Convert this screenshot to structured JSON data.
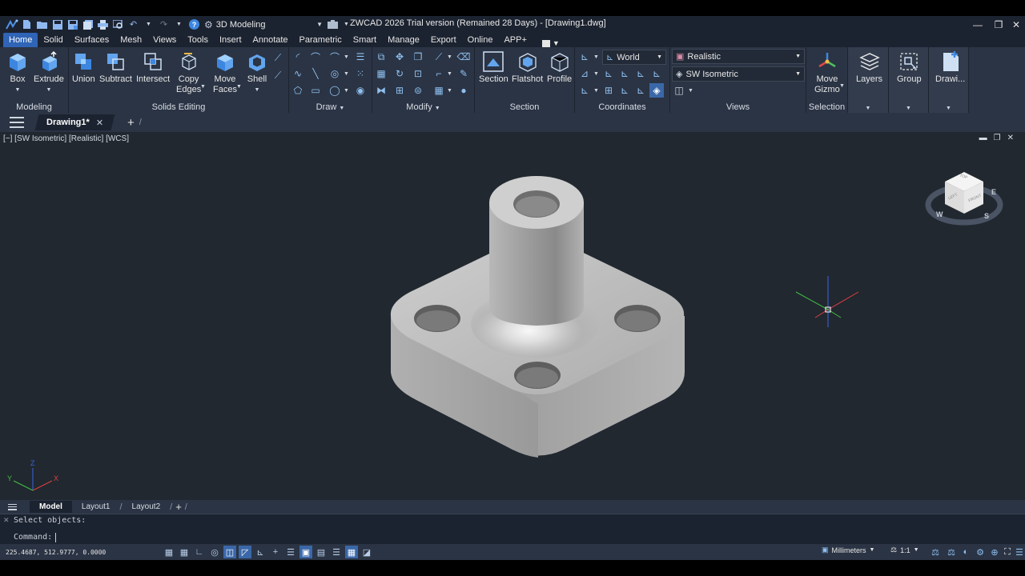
{
  "window": {
    "workspace": "3D Modeling",
    "title": "ZWCAD 2026 Trial version (Remained 28 Days) - [Drawing1.dwg]"
  },
  "tabs": [
    "Home",
    "Solid",
    "Surfaces",
    "Mesh",
    "Views",
    "Tools",
    "Insert",
    "Annotate",
    "Parametric",
    "Smart",
    "Manage",
    "Export",
    "Online",
    "APP+"
  ],
  "ribbon": {
    "modeling": {
      "title": "Modeling",
      "box": "Box",
      "extrude": "Extrude"
    },
    "solids_editing": {
      "title": "Solids Editing",
      "union": "Union",
      "subtract": "Subtract",
      "intersect": "Intersect",
      "copy_edges_1": "Copy",
      "copy_edges_2": "Edges",
      "move_faces_1": "Move",
      "move_faces_2": "Faces",
      "shell": "Shell"
    },
    "draw": {
      "title": "Draw"
    },
    "modify": {
      "title": "Modify"
    },
    "section": {
      "title": "Section",
      "section": "Section",
      "flatshot": "Flatshot",
      "profile": "Profile"
    },
    "coordinates": {
      "title": "Coordinates",
      "ucs": "World"
    },
    "views": {
      "title": "Views",
      "visual_style": "Realistic",
      "view": "SW Isometric"
    },
    "selection": {
      "title": "Selection",
      "move_gizmo_1": "Move",
      "move_gizmo_2": "Gizmo"
    },
    "layers": "Layers",
    "group": "Group",
    "drawing": "Drawi..."
  },
  "document": {
    "tab": "Drawing1*"
  },
  "viewport": {
    "label": "[−] [SW Isometric] [Realistic] [WCS]"
  },
  "viewcube": {
    "top": "TOP",
    "left": "LEFT",
    "front": "FRONT",
    "w": "W",
    "s": "S",
    "e": "E"
  },
  "ucs_icon": {
    "x": "X",
    "y": "Y",
    "z": "Z"
  },
  "layouts": [
    "Model",
    "Layout1",
    "Layout2"
  ],
  "command": {
    "history": "Select objects:",
    "prompt": "Command:"
  },
  "status": {
    "coords": "225.4687, 512.9777, 0.0000",
    "units": "Millimeters",
    "scale": "1:1"
  },
  "colors": {
    "accent": "#2f64b6",
    "ribbon": "#2b3444",
    "titlebar": "#1c2330",
    "viewport": "#212830"
  }
}
